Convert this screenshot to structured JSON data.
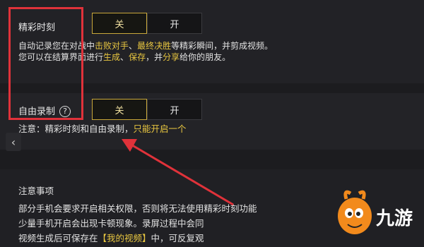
{
  "highlights": {
    "label": "精彩时刻",
    "off_label": "关",
    "on_label": "开",
    "desc_line1": {
      "p1": "自动记录您在",
      "p2": "对战中",
      "h1": "击败对手",
      "sep": "、",
      "h2": "最终决胜",
      "p3": "等精彩瞬间，并剪成视频。"
    },
    "desc_line2": {
      "p1": "您可以在结算",
      "p2": "界面进行",
      "h1": "生成",
      "sep": "、",
      "h2": "保存",
      "p3": "，并",
      "h3": "分享",
      "p4": "给你的朋友。"
    }
  },
  "free_record": {
    "label": "自由录制",
    "off_label": "关",
    "on_label": "开",
    "note_prefix": "注意：精彩时刻和自由录制，",
    "note_highlight": "只能开启一个"
  },
  "notes": {
    "title": "注意事项",
    "line1": "部分手机会要求开启相关权限，否则将无法使用精彩时刻功能",
    "line2": "少量手机开启会出现卡顿现象。录屏过程中会同",
    "line3_prefix": "视频生成后可保存在",
    "line3_bracket": "【我的视频】",
    "line3_suffix": "中，可反复观"
  },
  "back_icon": "‹",
  "logo_text": "九游",
  "colors": {
    "highlight": "#e8c640",
    "annotation": "#e0323a",
    "toggle_border": "#c9a83a"
  }
}
